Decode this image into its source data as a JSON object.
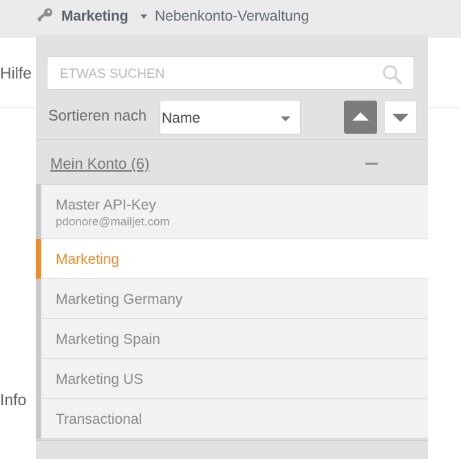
{
  "topbar": {
    "account_name": "Marketing",
    "subaccount_link": "Nebenkonto-Verwaltung"
  },
  "background": {
    "hilfe": "Hilfe",
    "info": "Info"
  },
  "search": {
    "placeholder": "ETWAS SUCHEN",
    "value": ""
  },
  "sort": {
    "label": "Sortieren nach",
    "selected": "Name"
  },
  "section": {
    "title": "Mein Konto (6)"
  },
  "accounts": [
    {
      "label": "Master API-Key",
      "sub": "pdonore@mailjet.com",
      "active": false
    },
    {
      "label": "Marketing",
      "active": true
    },
    {
      "label": "Marketing Germany",
      "active": false
    },
    {
      "label": "Marketing Spain",
      "active": false
    },
    {
      "label": "Marketing US",
      "active": false
    },
    {
      "label": "Transactional",
      "active": false
    }
  ],
  "colors": {
    "active_accent": "#ef8d2a",
    "panel_bg": "#e2e2e2"
  },
  "icons": {
    "key": "key-icon",
    "search": "search-icon",
    "collapse": "minus-icon",
    "sort_asc": "triangle-up-icon",
    "sort_desc": "triangle-down-icon"
  }
}
